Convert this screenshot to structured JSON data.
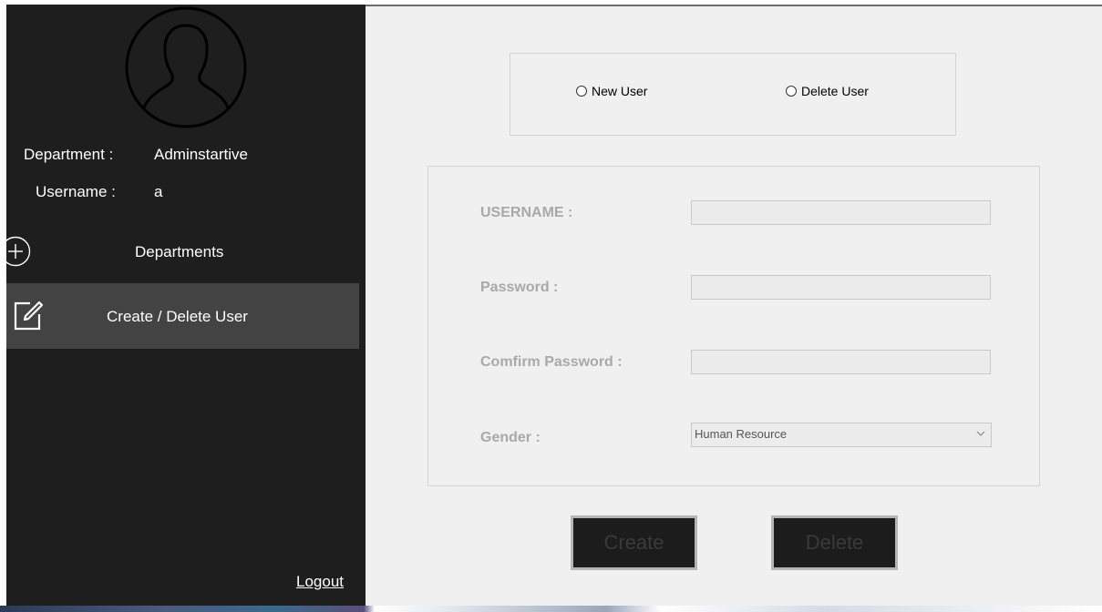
{
  "sidebar": {
    "department_label": "Department :",
    "department_value": "Adminstartive",
    "username_label": "Username :",
    "username_value": "a",
    "nav": [
      {
        "label": "Departments",
        "icon": "plus-circle-icon",
        "active": false
      },
      {
        "label": "Create / Delete User",
        "icon": "edit-icon",
        "active": true
      }
    ],
    "logout_label": "Logout"
  },
  "main": {
    "radio_new_user": "New User",
    "radio_delete_user": "Delete User",
    "form": {
      "username_label": "USERNAME :",
      "username_value": "",
      "password_label": "Password :",
      "password_value": "",
      "confirm_label": "Comfirm Password :",
      "confirm_value": "",
      "gender_label": "Gender :",
      "gender_selected": "Human Resource"
    },
    "create_label": "Create",
    "delete_label": "Delete"
  },
  "colors": {
    "sidebar_bg": "#1e1e1e",
    "sidebar_active": "#434343",
    "main_bg": "#f0f0f0",
    "button_bg": "#1c1c1c",
    "label_gray": "#a9a9a9"
  }
}
